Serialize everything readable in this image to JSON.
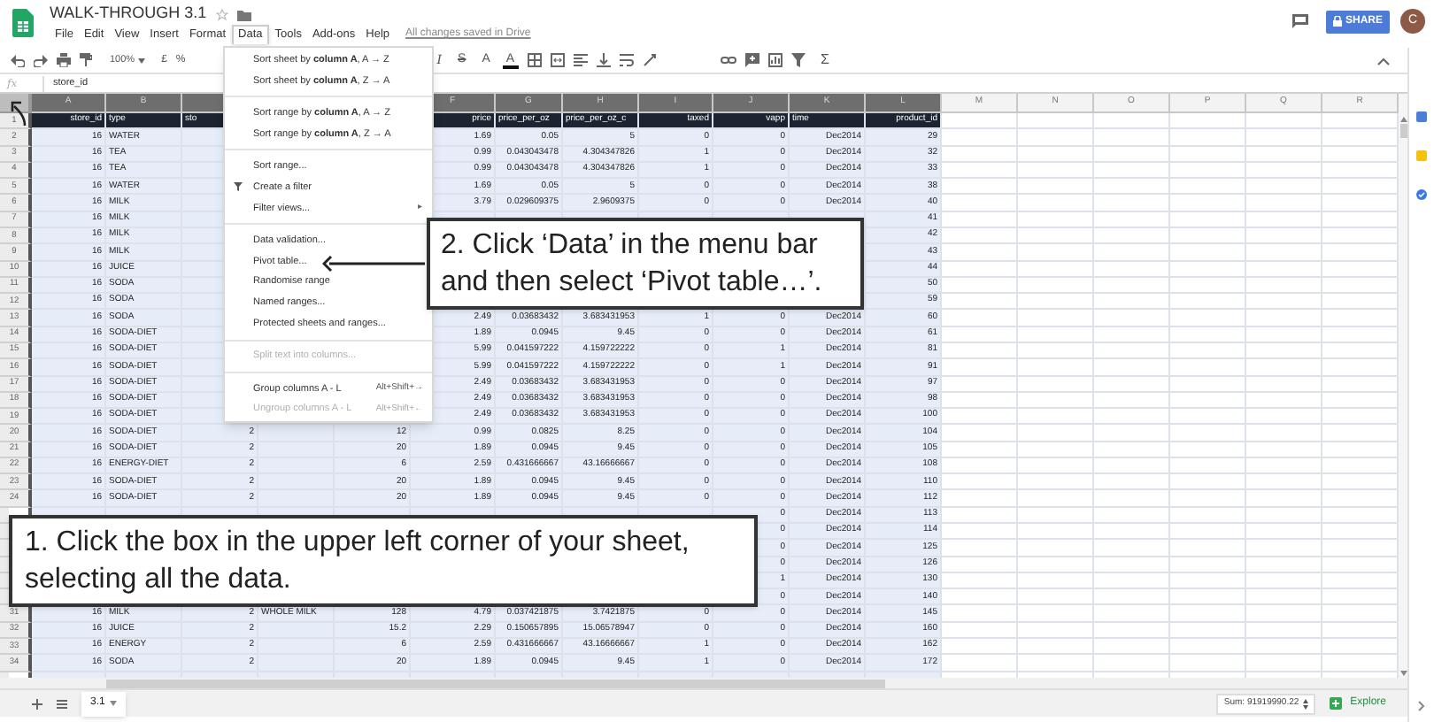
{
  "app": {
    "title": "WALK-THROUGH 3.1",
    "starred": false,
    "menus": [
      {
        "label": "File",
        "selected": false
      },
      {
        "label": "Edit",
        "selected": false
      },
      {
        "label": "View",
        "selected": false
      },
      {
        "label": "Insert",
        "selected": false
      },
      {
        "label": "Format",
        "selected": false
      },
      {
        "label": "Data",
        "selected": true
      },
      {
        "label": "Tools",
        "selected": false
      },
      {
        "label": "Add-ons",
        "selected": false
      },
      {
        "label": "Help",
        "selected": false
      }
    ],
    "save_status": "All changes saved in Drive",
    "share_label": "SHARE",
    "avatar": "C"
  },
  "toolbar": {
    "zoom": "100%",
    "currency": "£",
    "percent": "%",
    "text_buttons": [
      "I",
      "S",
      "A",
      "A"
    ],
    "functions": "Σ"
  },
  "formula_bar": {
    "label": "fx",
    "value": "store_id"
  },
  "sheet": {
    "all_selected": true,
    "columns": [
      {
        "letter": "A",
        "kind": "number"
      },
      {
        "letter": "B",
        "kind": "text"
      },
      {
        "kind": "number"
      },
      {
        "kind": "text"
      },
      {
        "kind": "number"
      },
      {
        "letter": "F",
        "kind": "number"
      },
      {
        "letter": "G",
        "kind": "number"
      },
      {
        "letter": "H",
        "kind": "number"
      },
      {
        "letter": "I",
        "kind": "number"
      },
      {
        "letter": "J",
        "kind": "number"
      },
      {
        "letter": "K",
        "kind": "date"
      },
      {
        "letter": "L",
        "kind": "number"
      },
      {
        "letter": "M",
        "kind": "empty"
      },
      {
        "letter": "N",
        "kind": "empty"
      },
      {
        "letter": "O",
        "kind": "empty"
      },
      {
        "letter": "P",
        "kind": "empty"
      },
      {
        "letter": "Q",
        "kind": "empty"
      },
      {
        "letter": "R",
        "kind": "empty"
      }
    ],
    "header_row": {
      "number": "1",
      "cells": [
        {
          "text": "store_id",
          "right_aligned": true
        },
        {
          "text": "type",
          "right_aligned": false
        },
        {
          "text": "sto",
          "right_aligned": false
        },
        null,
        null,
        {
          "text": "price",
          "right_aligned": true
        },
        {
          "text": "price_per_oz",
          "right_aligned": false
        },
        {
          "text": "price_per_oz_c",
          "right_aligned": false
        },
        {
          "text": "taxed",
          "right_aligned": true
        },
        {
          "text": "vapp",
          "right_aligned": true
        },
        {
          "text": "time",
          "right_aligned": false
        },
        {
          "text": "product_id",
          "right_aligned": true
        }
      ]
    },
    "rows": [
      {
        "number": "2",
        "cells": [
          "16",
          "WATER",
          null,
          null,
          null,
          "1.69",
          "0.05",
          "5",
          "0",
          "0",
          "Dec2014",
          "29"
        ]
      },
      {
        "number": "3",
        "cells": [
          "16",
          "TEA",
          null,
          null,
          null,
          "0.99",
          "0.043043478",
          "4.304347826",
          "1",
          "0",
          "Dec2014",
          "32"
        ]
      },
      {
        "number": "4",
        "cells": [
          "16",
          "TEA",
          null,
          null,
          null,
          "0.99",
          "0.043043478",
          "4.304347826",
          "1",
          "0",
          "Dec2014",
          "33"
        ]
      },
      {
        "number": "5",
        "cells": [
          "16",
          "WATER",
          null,
          null,
          null,
          "1.69",
          "0.05",
          "5",
          "0",
          "0",
          "Dec2014",
          "38"
        ]
      },
      {
        "number": "6",
        "cells": [
          "16",
          "MILK",
          null,
          null,
          null,
          "3.79",
          "0.029609375",
          "2.9609375",
          "0",
          "0",
          "Dec2014",
          "40"
        ]
      },
      {
        "number": "7",
        "cells": [
          "16",
          "MILK",
          null,
          null,
          null,
          null,
          null,
          null,
          null,
          null,
          null,
          "41"
        ]
      },
      {
        "number": "8",
        "cells": [
          "16",
          "MILK",
          null,
          null,
          null,
          null,
          null,
          null,
          null,
          null,
          null,
          "42"
        ]
      },
      {
        "number": "9",
        "cells": [
          "16",
          "MILK",
          null,
          null,
          null,
          null,
          null,
          null,
          null,
          null,
          null,
          "43"
        ]
      },
      {
        "number": "10",
        "cells": [
          "16",
          "JUICE",
          null,
          null,
          null,
          null,
          null,
          null,
          null,
          null,
          null,
          "44"
        ]
      },
      {
        "number": "11",
        "cells": [
          "16",
          "SODA",
          null,
          null,
          null,
          null,
          null,
          null,
          null,
          null,
          null,
          "50"
        ]
      },
      {
        "number": "12",
        "cells": [
          "16",
          "SODA",
          null,
          null,
          null,
          null,
          null,
          null,
          null,
          null,
          null,
          "59"
        ]
      },
      {
        "number": "13",
        "cells": [
          "16",
          "SODA",
          null,
          null,
          null,
          "2.49",
          "0.03683432",
          "3.683431953",
          "1",
          "0",
          "Dec2014",
          "60"
        ]
      },
      {
        "number": "14",
        "cells": [
          "16",
          "SODA-DIET",
          null,
          null,
          null,
          "1.89",
          "0.0945",
          "9.45",
          "0",
          "0",
          "Dec2014",
          "61"
        ]
      },
      {
        "number": "15",
        "cells": [
          "16",
          "SODA-DIET",
          null,
          null,
          null,
          "5.99",
          "0.041597222",
          "4.159722222",
          "0",
          "1",
          "Dec2014",
          "81"
        ]
      },
      {
        "number": "16",
        "cells": [
          "16",
          "SODA-DIET",
          null,
          null,
          null,
          "5.99",
          "0.041597222",
          "4.159722222",
          "0",
          "1",
          "Dec2014",
          "91"
        ]
      },
      {
        "number": "17",
        "cells": [
          "16",
          "SODA-DIET",
          null,
          null,
          null,
          "2.49",
          "0.03683432",
          "3.683431953",
          "0",
          "0",
          "Dec2014",
          "97"
        ]
      },
      {
        "number": "18",
        "cells": [
          "16",
          "SODA-DIET",
          null,
          null,
          null,
          "2.49",
          "0.03683432",
          "3.683431953",
          "0",
          "0",
          "Dec2014",
          "98"
        ]
      },
      {
        "number": "19",
        "cells": [
          "16",
          "SODA-DIET",
          null,
          null,
          null,
          "2.49",
          "0.03683432",
          "3.683431953",
          "0",
          "0",
          "Dec2014",
          "100"
        ]
      },
      {
        "number": "20",
        "cells": [
          "16",
          "SODA-DIET",
          "2",
          null,
          "12",
          "0.99",
          "0.0825",
          "8.25",
          "0",
          "0",
          "Dec2014",
          "104"
        ]
      },
      {
        "number": "21",
        "cells": [
          "16",
          "SODA-DIET",
          "2",
          null,
          "20",
          "1.89",
          "0.0945",
          "9.45",
          "0",
          "0",
          "Dec2014",
          "105"
        ]
      },
      {
        "number": "22",
        "cells": [
          "16",
          "ENERGY-DIET",
          "2",
          null,
          "6",
          "2.59",
          "0.431666667",
          "43.16666667",
          "0",
          "0",
          "Dec2014",
          "108"
        ]
      },
      {
        "number": "23",
        "cells": [
          "16",
          "SODA-DIET",
          "2",
          null,
          "20",
          "1.89",
          "0.0945",
          "9.45",
          "0",
          "0",
          "Dec2014",
          "110"
        ]
      },
      {
        "number": "24",
        "cells": [
          "16",
          "SODA-DIET",
          "2",
          null,
          "20",
          "1.89",
          "0.0945",
          "9.45",
          "0",
          "0",
          "Dec2014",
          "112"
        ]
      },
      {
        "number": null,
        "cells": [
          null,
          null,
          null,
          null,
          null,
          null,
          null,
          null,
          null,
          "0",
          "Dec2014",
          "113"
        ]
      },
      {
        "number": null,
        "cells": [
          null,
          null,
          null,
          null,
          null,
          null,
          null,
          null,
          null,
          "0",
          "Dec2014",
          "114"
        ]
      },
      {
        "number": null,
        "cells": [
          null,
          null,
          null,
          null,
          null,
          null,
          null,
          null,
          null,
          "0",
          "Dec2014",
          "125"
        ]
      },
      {
        "number": null,
        "cells": [
          null,
          null,
          null,
          null,
          null,
          null,
          null,
          null,
          null,
          "0",
          "Dec2014",
          "126"
        ]
      },
      {
        "number": null,
        "cells": [
          null,
          null,
          null,
          null,
          null,
          null,
          null,
          null,
          null,
          "1",
          "Dec2014",
          "130"
        ]
      },
      {
        "number": null,
        "cells": [
          null,
          null,
          null,
          null,
          null,
          null,
          null,
          null,
          null,
          "0",
          "Dec2014",
          "140"
        ]
      },
      {
        "number": "31",
        "cells": [
          "16",
          "MILK",
          "2",
          "WHOLE MILK",
          "128",
          "4.79",
          "0.037421875",
          "3.7421875",
          "0",
          "0",
          "Dec2014",
          "145"
        ]
      },
      {
        "number": "32",
        "cells": [
          "16",
          "JUICE",
          "2",
          null,
          "15.2",
          "2.29",
          "0.150657895",
          "15.06578947",
          "0",
          "0",
          "Dec2014",
          "160"
        ]
      },
      {
        "number": "33",
        "cells": [
          "16",
          "ENERGY",
          "2",
          null,
          "6",
          "2.59",
          "0.431666667",
          "43.16666667",
          "1",
          "0",
          "Dec2014",
          "162"
        ]
      },
      {
        "number": "34",
        "cells": [
          "16",
          "SODA",
          "2",
          null,
          "20",
          "1.89",
          "0.0945",
          "9.45",
          "1",
          "0",
          "Dec2014",
          "172"
        ]
      }
    ]
  },
  "data_menu": {
    "items": [
      {
        "kind": "item",
        "label": "Sort sheet by **column A**, A → Z",
        "disabled": false
      },
      {
        "kind": "item",
        "label": "Sort sheet by **column A**, Z → A",
        "disabled": false
      },
      {
        "kind": "divider"
      },
      {
        "kind": "item",
        "label": "Sort range by **column A**, A → Z",
        "disabled": false
      },
      {
        "kind": "item",
        "label": "Sort range by **column A**, Z → A",
        "disabled": false
      },
      {
        "kind": "divider"
      },
      {
        "kind": "item",
        "label": "Sort range...",
        "disabled": false
      },
      {
        "kind": "icon_item",
        "label": "Create a filter",
        "disabled": false
      },
      {
        "kind": "item",
        "label": "Filter views...",
        "disabled": false,
        "submenu": "▸"
      },
      {
        "kind": "divider"
      },
      {
        "kind": "item",
        "label": "Data validation...",
        "disabled": false
      },
      {
        "kind": "item",
        "label": "Pivot table...",
        "disabled": false
      },
      {
        "kind": "item",
        "label": "Randomise range",
        "disabled": false
      },
      {
        "kind": "item",
        "label": "Named ranges...",
        "disabled": false
      },
      {
        "kind": "item",
        "label": "Protected sheets and ranges...",
        "disabled": false
      },
      {
        "kind": "divider"
      },
      {
        "kind": "item",
        "label": "Split text into columns...",
        "disabled": true
      },
      {
        "kind": "divider"
      },
      {
        "kind": "item",
        "label": "Group columns A - L",
        "disabled": false,
        "shortcut": "Alt+Shift+→"
      },
      {
        "kind": "item",
        "label": "Ungroup columns A - L",
        "disabled": true,
        "shortcut": "Alt+Shift+←"
      }
    ]
  },
  "callouts": [
    {
      "text": "2. Click ‘Data’ in the menu bar and then select ‘Pivot table…’."
    },
    {
      "text": "1. Click the box in the upper left corner of your sheet, selecting all the data."
    }
  ],
  "bottom_bar": {
    "sheet_tabs": [
      {
        "label": "3.1",
        "selected": true
      }
    ],
    "sum": "Sum: 91919990.22",
    "explore": "Explore"
  }
}
